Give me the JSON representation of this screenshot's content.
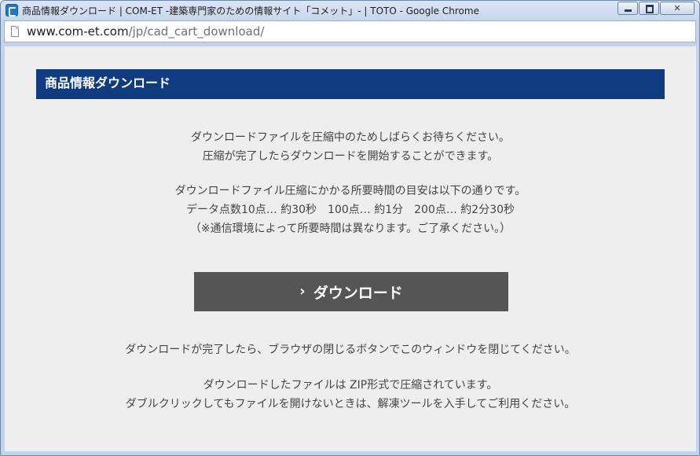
{
  "window": {
    "title": "商品情報ダウンロード | COM-ET -建築専門家のための情報サイト「コメット」- | TOTO - Google Chrome"
  },
  "address": {
    "domain": "www.com-et.com",
    "path": "/jp/cad_cart_download/"
  },
  "page": {
    "header": "商品情報ダウンロード",
    "wait_line1": "ダウンロードファイルを圧縮中のためしばらくお待ちください。",
    "wait_line2": "圧縮が完了したらダウンロードを開始することができます。",
    "time_line1": "ダウンロードファイル圧縮にかかる所要時間の目安は以下の通りです。",
    "time_line2": "データ点数10点… 約30秒　100点… 約1分　200点… 約2分30秒",
    "time_line3": "（※通信環境によって所要時間は異なります。ご了承ください。）",
    "download_button": {
      "icon": "chevron-right-icon",
      "label": "ダウンロード"
    },
    "close_line": "ダウンロードが完了したら、ブラウザの閉じるボタンでこのウィンドウを閉じてください。",
    "zip_line1": "ダウンロードしたファイルは ZIP形式で圧縮されています。",
    "zip_line2": "ダブルクリックしてもファイルを開けないときは、解凍ツールを入手してご利用ください。"
  },
  "colors": {
    "header_bg": "#0f3b80",
    "button_bg": "#555555",
    "content_bg": "#eeeeee"
  }
}
